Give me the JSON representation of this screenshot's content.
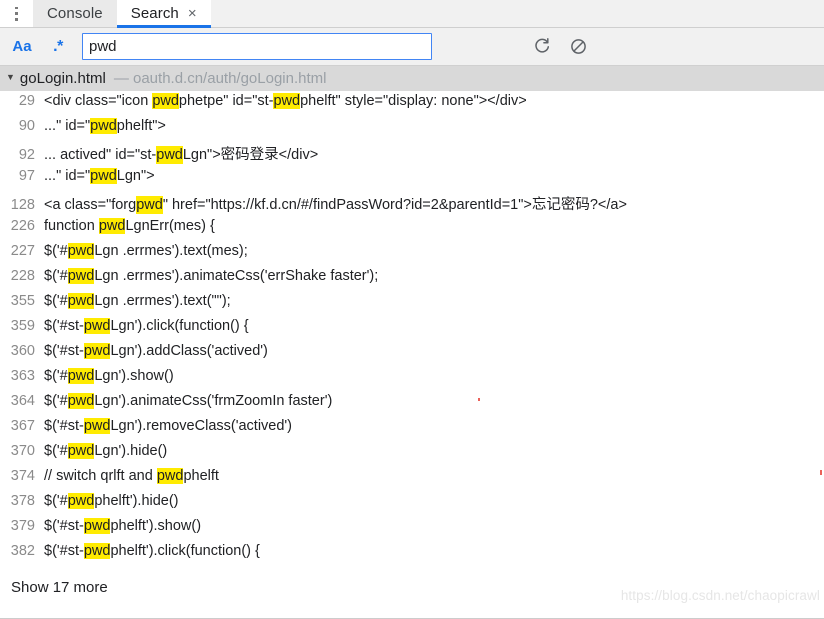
{
  "tabs": {
    "menu_icon": "kebab-menu-icon",
    "items": [
      {
        "label": "Console",
        "active": false,
        "closable": false
      },
      {
        "label": "Search",
        "active": true,
        "closable": true,
        "close_glyph": "×"
      }
    ]
  },
  "search": {
    "match_case_label": "Aa",
    "regex_label": ".*",
    "value": "pwd",
    "placeholder": "",
    "refresh_icon": "refresh-icon",
    "clear_icon": "clear-block-icon"
  },
  "file": {
    "disclosure_glyph": "▼",
    "name": "goLogin.html",
    "separator": "—",
    "url": "oauth.d.cn/auth/goLogin.html"
  },
  "query_term": "pwd",
  "results": [
    {
      "line": "29",
      "segments": [
        {
          "t": "<div class=\"icon ",
          "h": false
        },
        {
          "t": "pwd",
          "h": true
        },
        {
          "t": "phetpe\" id=\"st-",
          "h": false
        },
        {
          "t": "pwd",
          "h": true
        },
        {
          "t": "phelft\" style=\"display: none\"></div>",
          "h": false
        }
      ]
    },
    {
      "line": "90",
      "segments": [
        {
          "t": "...\" id=\"",
          "h": false
        },
        {
          "t": "pwd",
          "h": true
        },
        {
          "t": "phelft\">",
          "h": false
        }
      ]
    },
    {
      "line": "92",
      "segments": [
        {
          "t": "... actived\" id=\"st-",
          "h": false
        },
        {
          "t": "pwd",
          "h": true
        },
        {
          "t": "Lgn\">密码登录</div>",
          "h": false
        }
      ]
    },
    {
      "line": "97",
      "segments": [
        {
          "t": "...\" id=\"",
          "h": false
        },
        {
          "t": "pwd",
          "h": true
        },
        {
          "t": "Lgn\">",
          "h": false
        }
      ]
    },
    {
      "line": "128",
      "segments": [
        {
          "t": "<a class=\"forg",
          "h": false
        },
        {
          "t": "pwd",
          "h": true
        },
        {
          "t": "\" href=\"https://kf.d.cn/#/findPassWord?id=2&parentId=1\">忘记密码?</a>",
          "h": false
        }
      ]
    },
    {
      "line": "226",
      "segments": [
        {
          "t": "function ",
          "h": false
        },
        {
          "t": "pwd",
          "h": true
        },
        {
          "t": "LgnErr(mes) {",
          "h": false
        }
      ]
    },
    {
      "line": "227",
      "segments": [
        {
          "t": "$('#",
          "h": false
        },
        {
          "t": "pwd",
          "h": true
        },
        {
          "t": "Lgn .errmes').text(mes);",
          "h": false
        }
      ]
    },
    {
      "line": "228",
      "segments": [
        {
          "t": "$('#",
          "h": false
        },
        {
          "t": "pwd",
          "h": true
        },
        {
          "t": "Lgn .errmes').animateCss('errShake faster');",
          "h": false
        }
      ]
    },
    {
      "line": "355",
      "segments": [
        {
          "t": "$('#",
          "h": false
        },
        {
          "t": "pwd",
          "h": true
        },
        {
          "t": "Lgn .errmes').text(\"\");",
          "h": false
        }
      ]
    },
    {
      "line": "359",
      "segments": [
        {
          "t": "$('#st-",
          "h": false
        },
        {
          "t": "pwd",
          "h": true
        },
        {
          "t": "Lgn').click(function() {",
          "h": false
        }
      ]
    },
    {
      "line": "360",
      "segments": [
        {
          "t": "$('#st-",
          "h": false
        },
        {
          "t": "pwd",
          "h": true
        },
        {
          "t": "Lgn').addClass('actived')",
          "h": false
        }
      ]
    },
    {
      "line": "363",
      "segments": [
        {
          "t": "$('#",
          "h": false
        },
        {
          "t": "pwd",
          "h": true
        },
        {
          "t": "Lgn').show()",
          "h": false
        }
      ]
    },
    {
      "line": "364",
      "segments": [
        {
          "t": "$('#",
          "h": false
        },
        {
          "t": "pwd",
          "h": true
        },
        {
          "t": "Lgn').animateCss('frmZoomIn faster')",
          "h": false
        }
      ]
    },
    {
      "line": "367",
      "segments": [
        {
          "t": "$('#st-",
          "h": false
        },
        {
          "t": "pwd",
          "h": true
        },
        {
          "t": "Lgn').removeClass('actived')",
          "h": false
        }
      ]
    },
    {
      "line": "370",
      "segments": [
        {
          "t": "$('#",
          "h": false
        },
        {
          "t": "pwd",
          "h": true
        },
        {
          "t": "Lgn').hide()",
          "h": false
        }
      ]
    },
    {
      "line": "374",
      "segments": [
        {
          "t": "// switch qrlft and ",
          "h": false
        },
        {
          "t": "pwd",
          "h": true
        },
        {
          "t": "phelft",
          "h": false
        }
      ]
    },
    {
      "line": "378",
      "segments": [
        {
          "t": "$('#",
          "h": false
        },
        {
          "t": "pwd",
          "h": true
        },
        {
          "t": "phelft').hide()",
          "h": false
        }
      ]
    },
    {
      "line": "379",
      "segments": [
        {
          "t": "$('#st-",
          "h": false
        },
        {
          "t": "pwd",
          "h": true
        },
        {
          "t": "phelft').show()",
          "h": false
        }
      ]
    },
    {
      "line": "382",
      "segments": [
        {
          "t": "$('#st-",
          "h": false
        },
        {
          "t": "pwd",
          "h": true
        },
        {
          "t": "phelft').click(function() {",
          "h": false
        }
      ]
    }
  ],
  "show_more": {
    "label": "Show 17 more",
    "count": 17
  },
  "watermark": "https://blog.csdn.net/chaopicrawl",
  "colors": {
    "accent": "#1a73e8",
    "highlight": "#ffeb00",
    "tabstrip_bg": "#f1f1f1",
    "file_header_bg": "#d9d9d9",
    "line_number": "#8a8a8a",
    "url_text": "#9aa0a6"
  }
}
